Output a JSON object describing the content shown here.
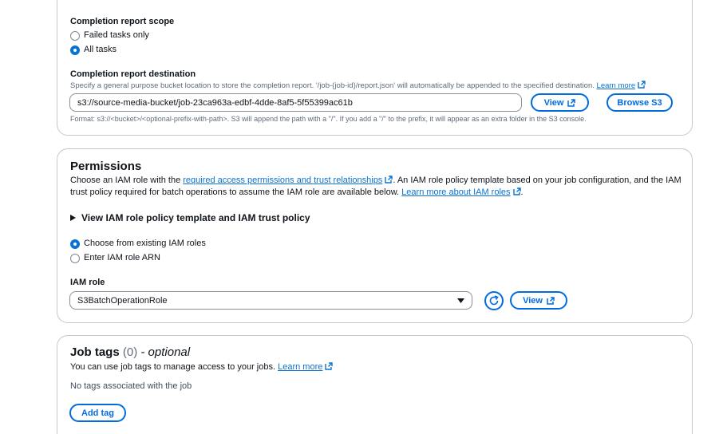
{
  "completion_report": {
    "scope_label": "Completion report scope",
    "scope_options": [
      "Failed tasks only",
      "All tasks"
    ],
    "scope_selected": "All tasks",
    "destination_label": "Completion report destination",
    "destination_desc": "Specify a general purpose bucket location to store the completion report. '/job-{job-id}/report.json' will automatically be appended to the specified destination.",
    "learn_more": "Learn more",
    "destination_value": "s3://source-media-bucket/job-23ca963a-edbf-4dde-8af5-5f55399ac61b",
    "view_button": "View",
    "browse_button": "Browse S3",
    "format_hint": "Format: s3://<bucket>/<optional-prefix-with-path>. S3 will append the path with a \"/\". If you add a \"/\" to the prefix, it will appear as an extra folder in the S3 console."
  },
  "permissions": {
    "title": "Permissions",
    "desc_part1": "Choose an IAM role with the ",
    "desc_link1": "required access permissions and trust relationships",
    "desc_part2": ". An IAM role policy template based on your job configuration, and the IAM",
    "desc_part3": "trust policy required for batch operations to assume the IAM role are available below. ",
    "desc_link2": "Learn more about IAM roles",
    "desc_end": ".",
    "expander_label": "View IAM role policy template and IAM trust policy",
    "role_options": [
      "Choose from existing IAM roles",
      "Enter IAM role ARN"
    ],
    "role_selected": "Choose from existing IAM roles",
    "iam_role_label": "IAM role",
    "iam_role_value": "S3BatchOperationRole",
    "view_button": "View"
  },
  "job_tags": {
    "title": "Job tags",
    "count": "(0)",
    "optional": "- optional",
    "desc": "You can use job tags to manage access to your jobs.",
    "learn_more": "Learn more",
    "empty_text": "No tags associated with the job",
    "add_button": "Add tag"
  },
  "colors": {
    "accent": "#0972d3",
    "border": "#c6c6cd",
    "text": "#0f141a",
    "muted": "#5f6b7a"
  }
}
